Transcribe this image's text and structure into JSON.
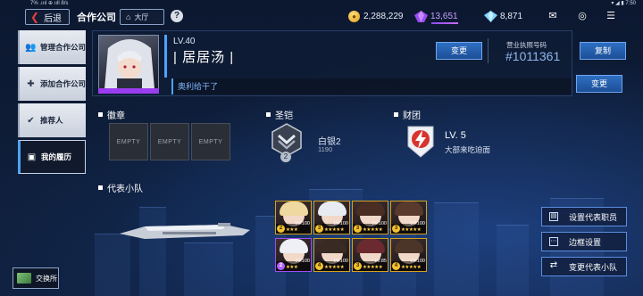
{
  "status_bar": {
    "left": "7%  .ıııl ⊕ ııll  8/s",
    "right": "▾ ◢ ▮ 7:50"
  },
  "header": {
    "back_label": "后退",
    "title": "合作公司",
    "home_label": "大厅",
    "help_label": "?",
    "coins": "2,288,229",
    "purple_gems": "13,651",
    "blue_gems": "8,871"
  },
  "sidebar": {
    "items": [
      {
        "label": "管理合作公司",
        "icon": "users-icon"
      },
      {
        "label": "添加合作公司",
        "icon": "add-user-icon"
      },
      {
        "label": "推荐人",
        "icon": "user-check-icon"
      },
      {
        "label": "我的履历",
        "icon": "id-card-icon"
      }
    ],
    "exchange_label": "交换所"
  },
  "profile": {
    "level": "LV.40",
    "name": "| 居居汤 |",
    "change_label": "变更",
    "license_label": "营业执照号码",
    "license_number": "#1011361",
    "copy_label": "复制",
    "motto": "奥利给干了",
    "motto_change_label": "变更"
  },
  "badges": {
    "title": "徽章",
    "slots": [
      "EMPTY",
      "EMPTY",
      "EMPTY"
    ]
  },
  "armor": {
    "title": "圣铠",
    "name": "白银2",
    "score": "1190",
    "count": "2"
  },
  "corp": {
    "title": "财团",
    "level": "LV. 5",
    "name": "大部来吃迫面"
  },
  "squad": {
    "title": "代表小队",
    "members": [
      {
        "rank": "2",
        "level": "LV.100",
        "stars": "★★★",
        "frame": "gold"
      },
      {
        "rank": "3",
        "level": "LV.100",
        "stars": "★★★★★",
        "frame": "gold"
      },
      {
        "rank": "3",
        "level": "LV.100",
        "stars": "★★★★★",
        "frame": "gold"
      },
      {
        "rank": "3",
        "level": "LV.100",
        "stars": "★★★★★",
        "frame": "gold"
      },
      {
        "rank": "2",
        "level": "LV.100",
        "stars": "★★★",
        "frame": "purple"
      },
      {
        "rank": "4",
        "level": "LV.100",
        "stars": "★★★★★",
        "frame": "gold"
      },
      {
        "rank": "3",
        "level": "LV.85",
        "stars": "★★★★★",
        "frame": "gold"
      },
      {
        "rank": "4",
        "level": "LV.100",
        "stars": "★★★★★",
        "frame": "gold"
      }
    ],
    "actions": [
      "设置代表职员",
      "边框设置",
      "变更代表小队"
    ]
  },
  "colors": {
    "accent": "#4ea2ff",
    "gold_frame": "#d3a21f",
    "purple_frame": "#a04df0",
    "emblem_red": "#d8332c"
  }
}
